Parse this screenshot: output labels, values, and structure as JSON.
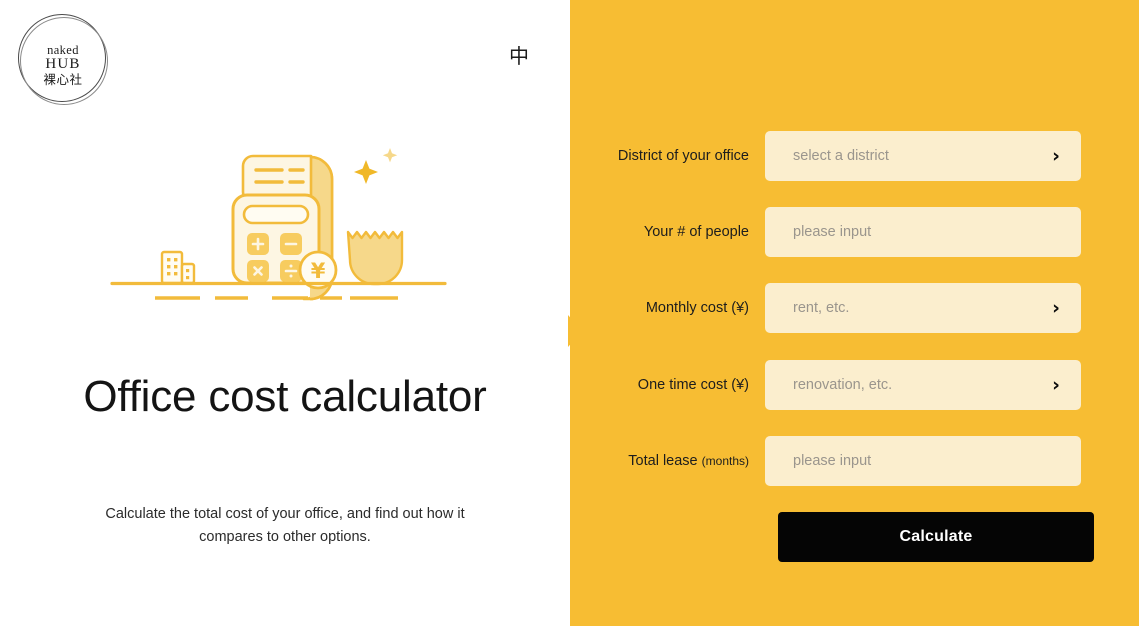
{
  "brand": {
    "logo_line1": "naked",
    "logo_line2": "HUB",
    "logo_line3": "裸心社",
    "accent_color": "#F7BD33",
    "field_color": "#FBEECE",
    "button_color": "#050505"
  },
  "header": {
    "language_toggle": "中"
  },
  "hero": {
    "title": "Office cost calculator",
    "subtitle": "Calculate the total cost of your office, and find out how it compares to other options.",
    "illustration_name": "calculator-receipt-illustration"
  },
  "form": {
    "fields": [
      {
        "label": "District of your office",
        "label_sub": "",
        "placeholder": "select a district",
        "value": "",
        "type": "select",
        "chevron": "›",
        "name": "district-field"
      },
      {
        "label": "Your # of people",
        "label_sub": "",
        "placeholder": "please input",
        "value": "",
        "type": "input",
        "chevron": "",
        "name": "people-count-field"
      },
      {
        "label": "Monthly cost (¥)",
        "label_sub": "",
        "placeholder": "rent, etc.",
        "value": "",
        "type": "select",
        "chevron": "›",
        "name": "monthly-cost-field"
      },
      {
        "label": "One time cost (¥)",
        "label_sub": "",
        "placeholder": "renovation, etc.",
        "value": "",
        "type": "select",
        "chevron": "›",
        "name": "one-time-cost-field"
      },
      {
        "label": "Total lease ",
        "label_sub": "(months)",
        "placeholder": "please input",
        "value": "",
        "type": "input",
        "chevron": "",
        "name": "total-lease-field"
      }
    ],
    "submit_label": "Calculate"
  }
}
